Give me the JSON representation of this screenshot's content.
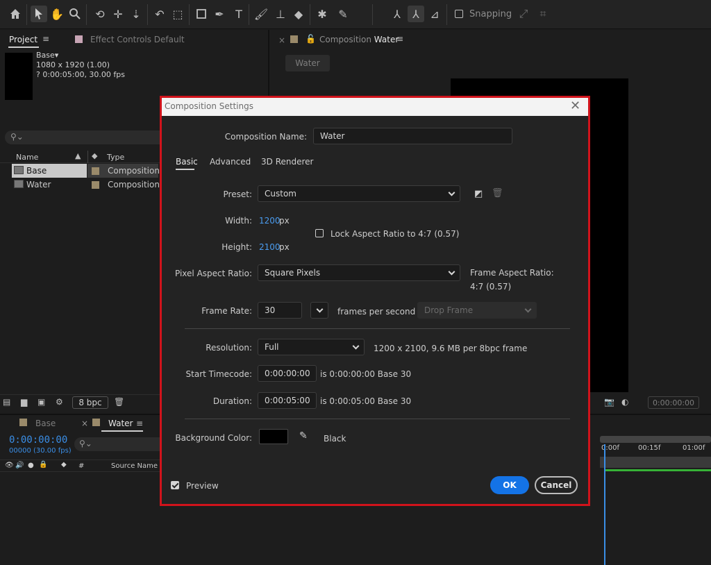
{
  "toolbar": {
    "snapping_label": "Snapping",
    "icons": [
      "home-icon",
      "selection-arrow-icon",
      "hand-icon",
      "zoom-icon",
      "rotate-icon",
      "anchor-icon",
      "move-behind-icon",
      "undo-icon",
      "marquee-icon",
      "rectangle-icon",
      "pen-icon",
      "type-icon",
      "brush-icon",
      "clone-stamp-icon",
      "eraser-icon",
      "roto-brush-icon",
      "puppet-icon"
    ]
  },
  "project_panel": {
    "tab_project": "Project",
    "tab_effect_controls": "Effect Controls Default",
    "selected_name": "Base",
    "info_line1": "1080 x 1920 (1.00)",
    "info_line2": "? 0:00:05:00, 30.00 fps",
    "col_name": "Name",
    "col_type": "Type",
    "rows": [
      {
        "name": "Base",
        "type": "Composition"
      },
      {
        "name": "Water",
        "type": "Composition"
      }
    ],
    "bpc": "8 bpc"
  },
  "viewer": {
    "tab_prefix": "Composition",
    "tab_name": "Water",
    "chip": "Water",
    "timecode": "0:00:00:00"
  },
  "timeline": {
    "tab_base": "Base",
    "tab_water": "Water",
    "timecode": "0:00:00:00",
    "timecode_sub": "00000 (30.00 fps)",
    "col_hash": "#",
    "col_source": "Source Name",
    "ruler_labels": [
      "0:00f",
      "00:15f",
      "01:00f"
    ]
  },
  "dialog": {
    "title": "Composition Settings",
    "comp_name_label": "Composition Name:",
    "comp_name_value": "Water",
    "tabs": [
      "Basic",
      "Advanced",
      "3D Renderer"
    ],
    "preset_label": "Preset:",
    "preset_value": "Custom",
    "width_label": "Width:",
    "width_value": "1200",
    "height_label": "Height:",
    "height_value": "2100",
    "px": "px",
    "lock_label": "Lock Aspect Ratio to 4:7 (0.57)",
    "par_label": "Pixel Aspect Ratio:",
    "par_value": "Square Pixels",
    "far_label": "Frame Aspect Ratio:",
    "far_value": "4:7 (0.57)",
    "fr_label": "Frame Rate:",
    "fr_value": "30",
    "fr_unit": "frames per second",
    "drop_frame": "Drop Frame",
    "res_label": "Resolution:",
    "res_value": "Full",
    "res_info": "1200 x 2100, 9.6 MB per 8bpc frame",
    "start_label": "Start Timecode:",
    "start_value": "0:00:00:00",
    "start_info": "is 0:00:00:00  Base 30",
    "dur_label": "Duration:",
    "dur_value": "0:00:05:00",
    "dur_info": "is 0:00:05:00  Base 30",
    "bg_label": "Background Color:",
    "bg_value": "Black",
    "preview_label": "Preview",
    "ok": "OK",
    "cancel": "Cancel",
    "highlight_color": "#d0131b",
    "accent_color": "#1473e6"
  }
}
